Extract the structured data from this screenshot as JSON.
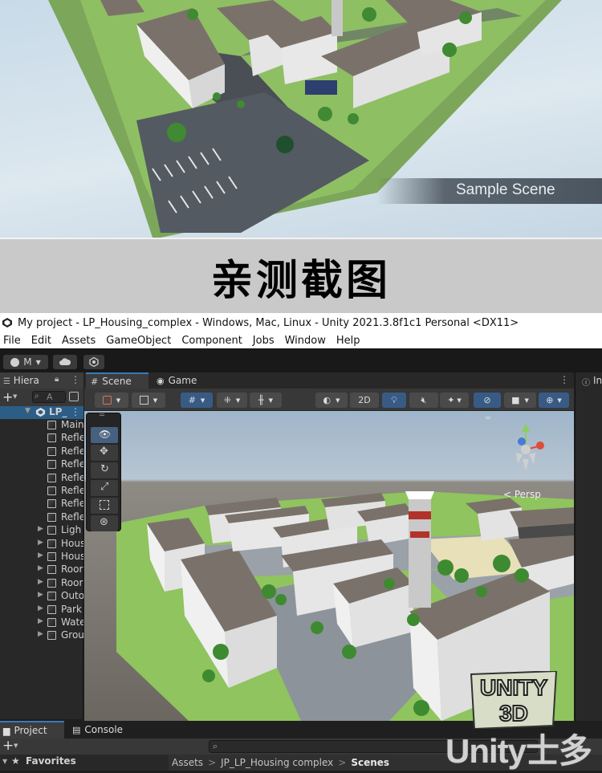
{
  "promo": {
    "banner_text": "Sample Scene"
  },
  "caption": {
    "text": "亲测截图"
  },
  "window": {
    "title": "My project - LP_Housing_complex - Windows, Mac, Linux - Unity 2021.3.8f1c1 Personal <DX11>"
  },
  "menu": {
    "items": [
      "File",
      "Edit",
      "Assets",
      "GameObject",
      "Component",
      "Jobs",
      "Window",
      "Help"
    ]
  },
  "toolbar": {
    "account_label": "M",
    "account_icon": "account-icon",
    "cloud_icon": "cloud-icon",
    "collab_icon": "collab-icon"
  },
  "hierarchy": {
    "tab_label": "Hiera",
    "search_placeholder": "A",
    "root_label": "LP_",
    "items": [
      {
        "label": "Main",
        "expandable": false
      },
      {
        "label": "Refle",
        "expandable": false
      },
      {
        "label": "Refle",
        "expandable": false
      },
      {
        "label": "Refle",
        "expandable": false
      },
      {
        "label": "Refle",
        "expandable": false
      },
      {
        "label": "Refle",
        "expandable": false
      },
      {
        "label": "Refle",
        "expandable": false
      },
      {
        "label": "Refle",
        "expandable": false
      },
      {
        "label": "Ligh",
        "expandable": true
      },
      {
        "label": "Hous",
        "expandable": true
      },
      {
        "label": "Hous",
        "expandable": true
      },
      {
        "label": "Roor",
        "expandable": true
      },
      {
        "label": "Roor",
        "expandable": true
      },
      {
        "label": "Outo",
        "expandable": true
      },
      {
        "label": "Park",
        "expandable": true
      },
      {
        "label": "Wate",
        "expandable": true
      },
      {
        "label": "Grou",
        "expandable": true
      }
    ]
  },
  "scene": {
    "tabs": [
      {
        "label": "Scene",
        "active": true
      },
      {
        "label": "Game",
        "active": false
      }
    ],
    "mode_2d": "2D",
    "gizmo_label": "< Persp"
  },
  "inspector": {
    "tab_label": "In"
  },
  "project": {
    "tabs": [
      {
        "label": "Project",
        "active": true
      },
      {
        "label": "Console",
        "active": false
      }
    ],
    "favorites_label": "Favorites",
    "breadcrumb": [
      "Assets",
      "JP_LP_Housing complex",
      "Scenes"
    ]
  },
  "watermarks": {
    "badge_line1": "UNITY",
    "badge_line2": "3D",
    "brand": "Unity士多"
  },
  "colors": {
    "unity_bg": "#282828",
    "accent_blue": "#385b86",
    "grass": "#8fc45e",
    "building_wall": "#e8e8e8",
    "roof": "#7a726a"
  }
}
